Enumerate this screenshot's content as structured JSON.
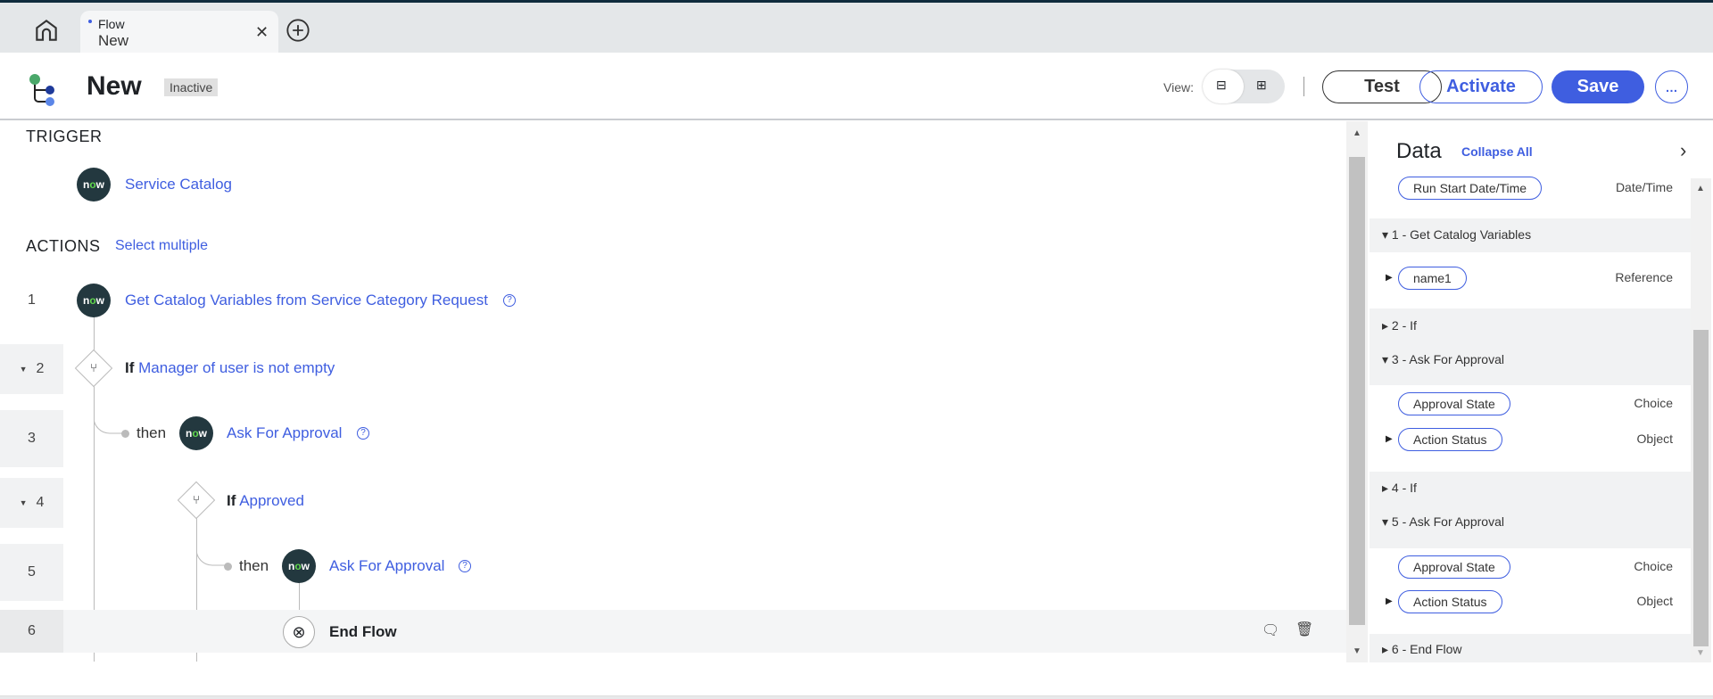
{
  "tabs": {
    "home_icon": "home-icon",
    "tab": {
      "type": "Flow",
      "name": "New"
    },
    "add_icon": "plus-circle-icon"
  },
  "header": {
    "title": "New",
    "status": "Inactive",
    "view_label": "View:",
    "buttons": {
      "test": "Test",
      "activate": "Activate",
      "save": "Save",
      "more": "…"
    }
  },
  "canvas": {
    "trigger_heading": "TRIGGER",
    "trigger": "Service Catalog",
    "actions_heading": "ACTIONS",
    "select_multiple": "Select multiple",
    "steps": [
      {
        "num": "1",
        "label": "Get Catalog Variables from Service Category Request"
      },
      {
        "num": "2",
        "keyword": "If",
        "label": "Manager of user is not empty"
      },
      {
        "num": "3",
        "then": "then",
        "label": "Ask For Approval"
      },
      {
        "num": "4",
        "keyword": "If",
        "label": "Approved"
      },
      {
        "num": "5",
        "then": "then",
        "label": "Ask For Approval"
      },
      {
        "num": "6",
        "label": "End Flow"
      }
    ],
    "now_logo": {
      "a": "n",
      "b": "o",
      "c": "w"
    }
  },
  "data_panel": {
    "title": "Data",
    "collapse_all": "Collapse All",
    "run_start": {
      "name": "Run Start Date/Time",
      "type": "Date/Time"
    },
    "groups": [
      {
        "label": "1 - Get Catalog Variables",
        "items": [
          {
            "name": "name1",
            "type": "Reference"
          }
        ]
      },
      {
        "label": "2 - If"
      },
      {
        "label": "3 - Ask For Approval",
        "items": [
          {
            "name": "Approval State",
            "type": "Choice"
          },
          {
            "name": "Action Status",
            "type": "Object"
          }
        ]
      },
      {
        "label": "4 - If"
      },
      {
        "label": "5 - Ask For Approval",
        "items": [
          {
            "name": "Approval State",
            "type": "Choice"
          },
          {
            "name": "Action Status",
            "type": "Object"
          }
        ]
      },
      {
        "label": "6 - End Flow"
      }
    ]
  },
  "colors": {
    "accent": "#3f5ee0",
    "now_bg": "#23383f",
    "now_green": "#62d84e"
  }
}
